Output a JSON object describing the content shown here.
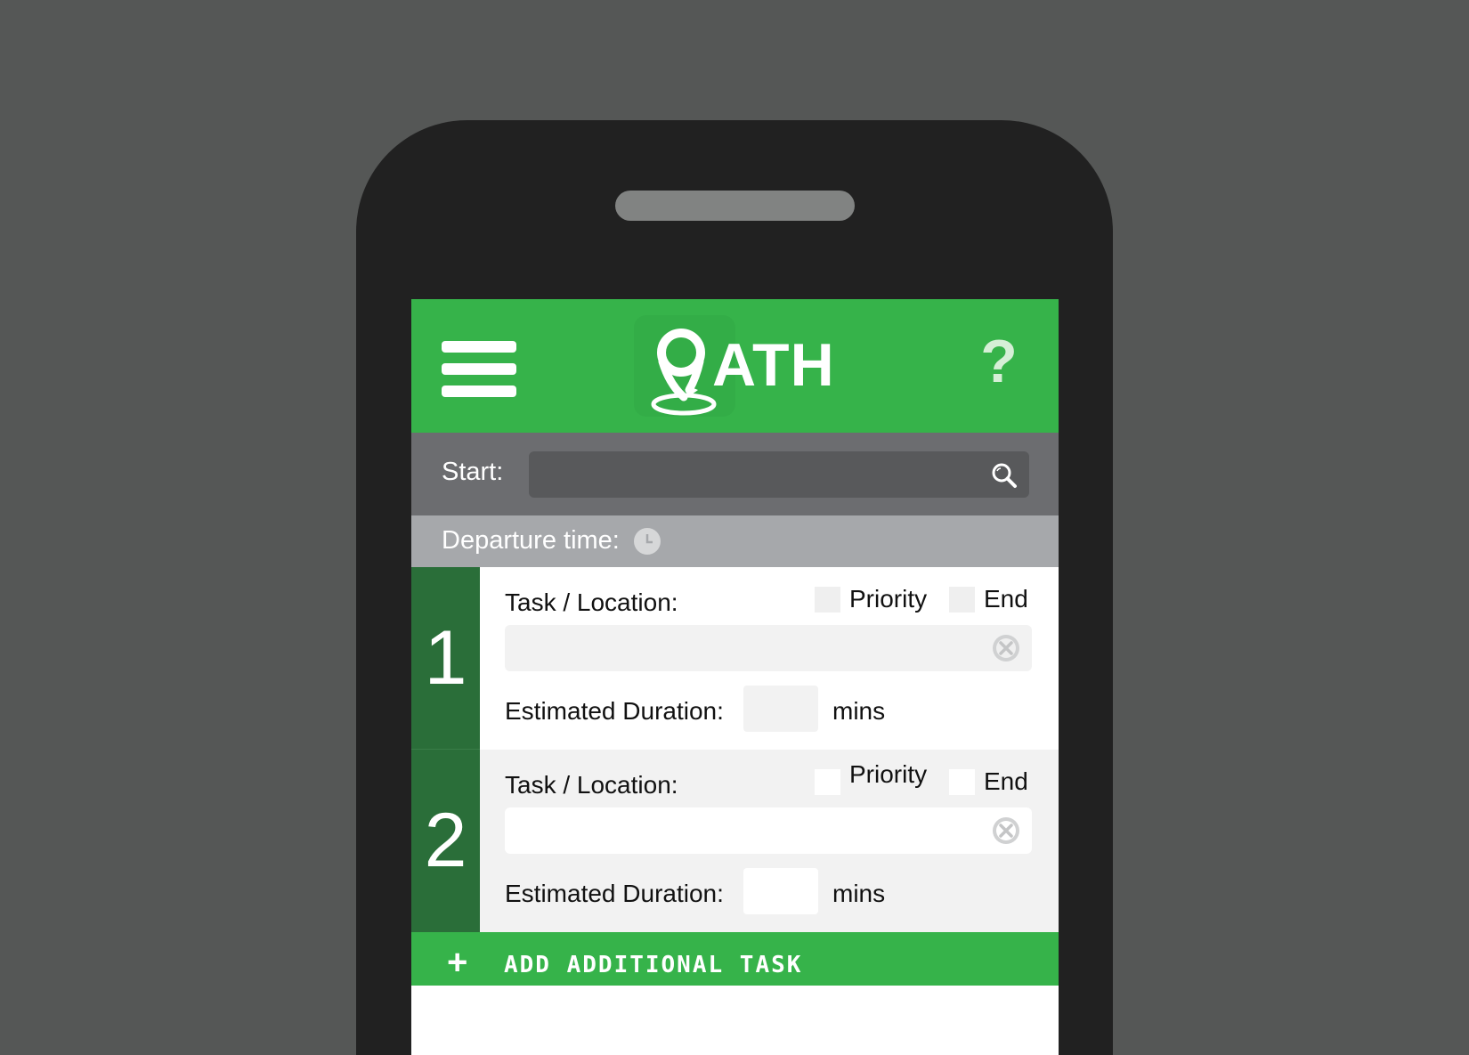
{
  "header": {
    "logo_text": "ATH",
    "help_label": "?"
  },
  "start": {
    "label": "Start:",
    "value": "",
    "placeholder": ""
  },
  "departure": {
    "label": "Departure time:"
  },
  "tasks": [
    {
      "number": "1",
      "task_label": "Task / Location:",
      "priority_label": "Priority",
      "end_label": "End",
      "task_value": "",
      "duration_label": "Estimated Duration:",
      "duration_value": "",
      "duration_unit": "mins"
    },
    {
      "number": "2",
      "task_label": "Task / Location:",
      "priority_label": "Priority",
      "end_label": "End",
      "task_value": "",
      "duration_label": "Estimated Duration:",
      "duration_value": "",
      "duration_unit": "mins"
    }
  ],
  "add_task": {
    "icon": "+",
    "label": "ADD ADDITIONAL TASK"
  },
  "colors": {
    "brand_green": "#36b34a",
    "task_number_green": "#2a6e39",
    "start_bar": "#6c6d70",
    "departure_bar": "#a6a8ab"
  }
}
